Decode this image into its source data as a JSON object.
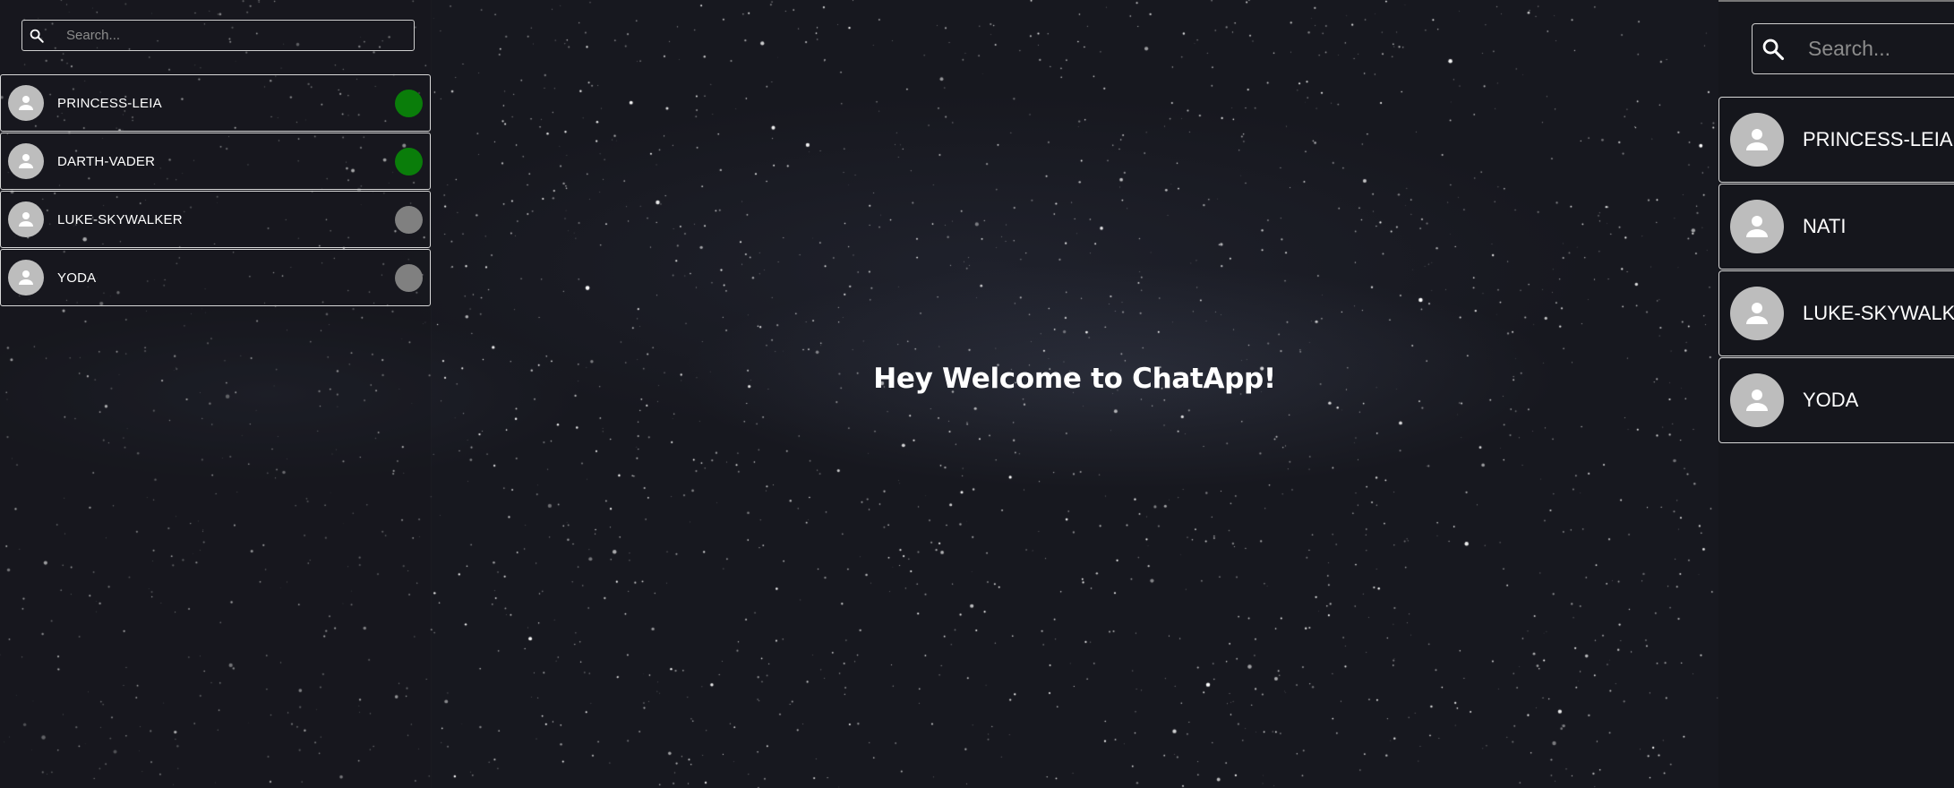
{
  "search": {
    "placeholder": "Search..."
  },
  "sidebar": {
    "users": [
      {
        "name": "PRINCESS-LEIA",
        "status": "online",
        "status_color": "#0a7d0a"
      },
      {
        "name": "DARTH-VADER",
        "status": "online",
        "status_color": "#0a7d0a"
      },
      {
        "name": "LUKE-SKYWALKER",
        "status": "offline",
        "status_color": "#808080"
      },
      {
        "name": "YODA",
        "status": "offline",
        "status_color": "#808080"
      }
    ]
  },
  "main": {
    "welcome_text": "Hey Welcome to ChatApp!"
  },
  "right_panel": {
    "search_placeholder": "Search...",
    "users": [
      {
        "name": "PRINCESS-LEIA"
      },
      {
        "name": "NATI"
      },
      {
        "name": "LUKE-SKYWALKER"
      },
      {
        "name": "YODA"
      }
    ]
  },
  "colors": {
    "background": "#17181f",
    "border": "#d8d8d8",
    "avatar": "#bdbdbd",
    "online": "#0a7d0a",
    "offline": "#808080"
  }
}
